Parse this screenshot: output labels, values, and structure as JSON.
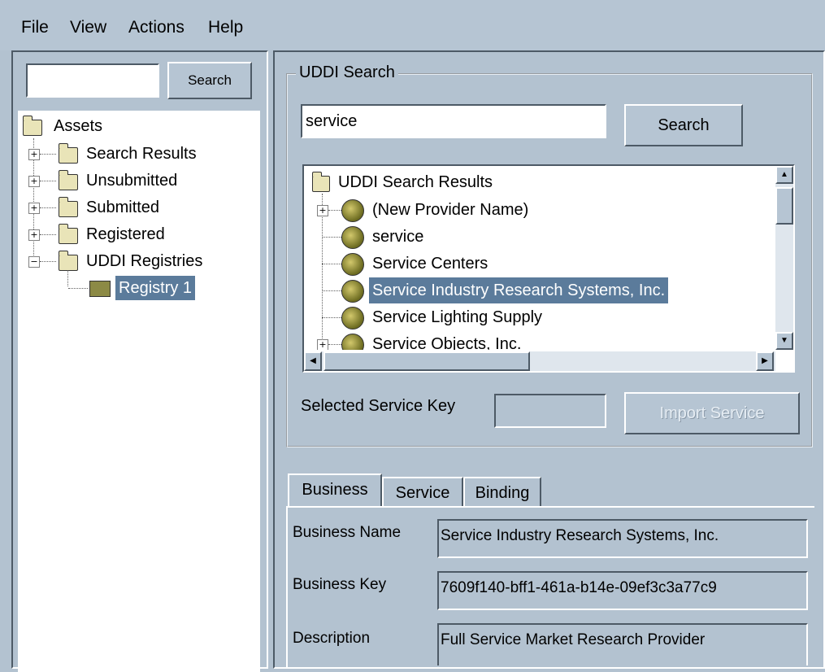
{
  "menu": {
    "file": "File",
    "view": "View",
    "actions": "Actions",
    "help": "Help"
  },
  "left": {
    "search_value": "",
    "search_button": "Search",
    "tree": {
      "root": "Assets",
      "search_results": "Search Results",
      "unsubmitted": "Unsubmitted",
      "submitted": "Submitted",
      "registered": "Registered",
      "uddi_registries": "UDDI Registries",
      "registry1": "Registry 1"
    }
  },
  "uddi": {
    "group_title": "UDDI Search",
    "search_value": "service",
    "search_button": "Search",
    "results_root": "UDDI Search Results",
    "results": [
      "(New Provider Name)",
      "service",
      "Service Centers",
      "Service Industry Research Systems, Inc.",
      "Service Lighting Supply",
      "Service Objects, Inc."
    ],
    "selected_key_label": "Selected Service Key",
    "selected_key_value": "",
    "import_button": "Import Service"
  },
  "tabs": {
    "business": "Business",
    "service": "Service",
    "binding": "Binding"
  },
  "business": {
    "name_label": "Business Name",
    "name_value": "Service Industry Research Systems, Inc.",
    "key_label": "Business Key",
    "key_value": "7609f140-bff1-461a-b14e-09ef3c3a77c9",
    "description_label": "Description",
    "description_value": "Full Service Market Research Provider"
  },
  "colors": {
    "background": "#b3c2d0",
    "selection": "#5b7b9b"
  }
}
